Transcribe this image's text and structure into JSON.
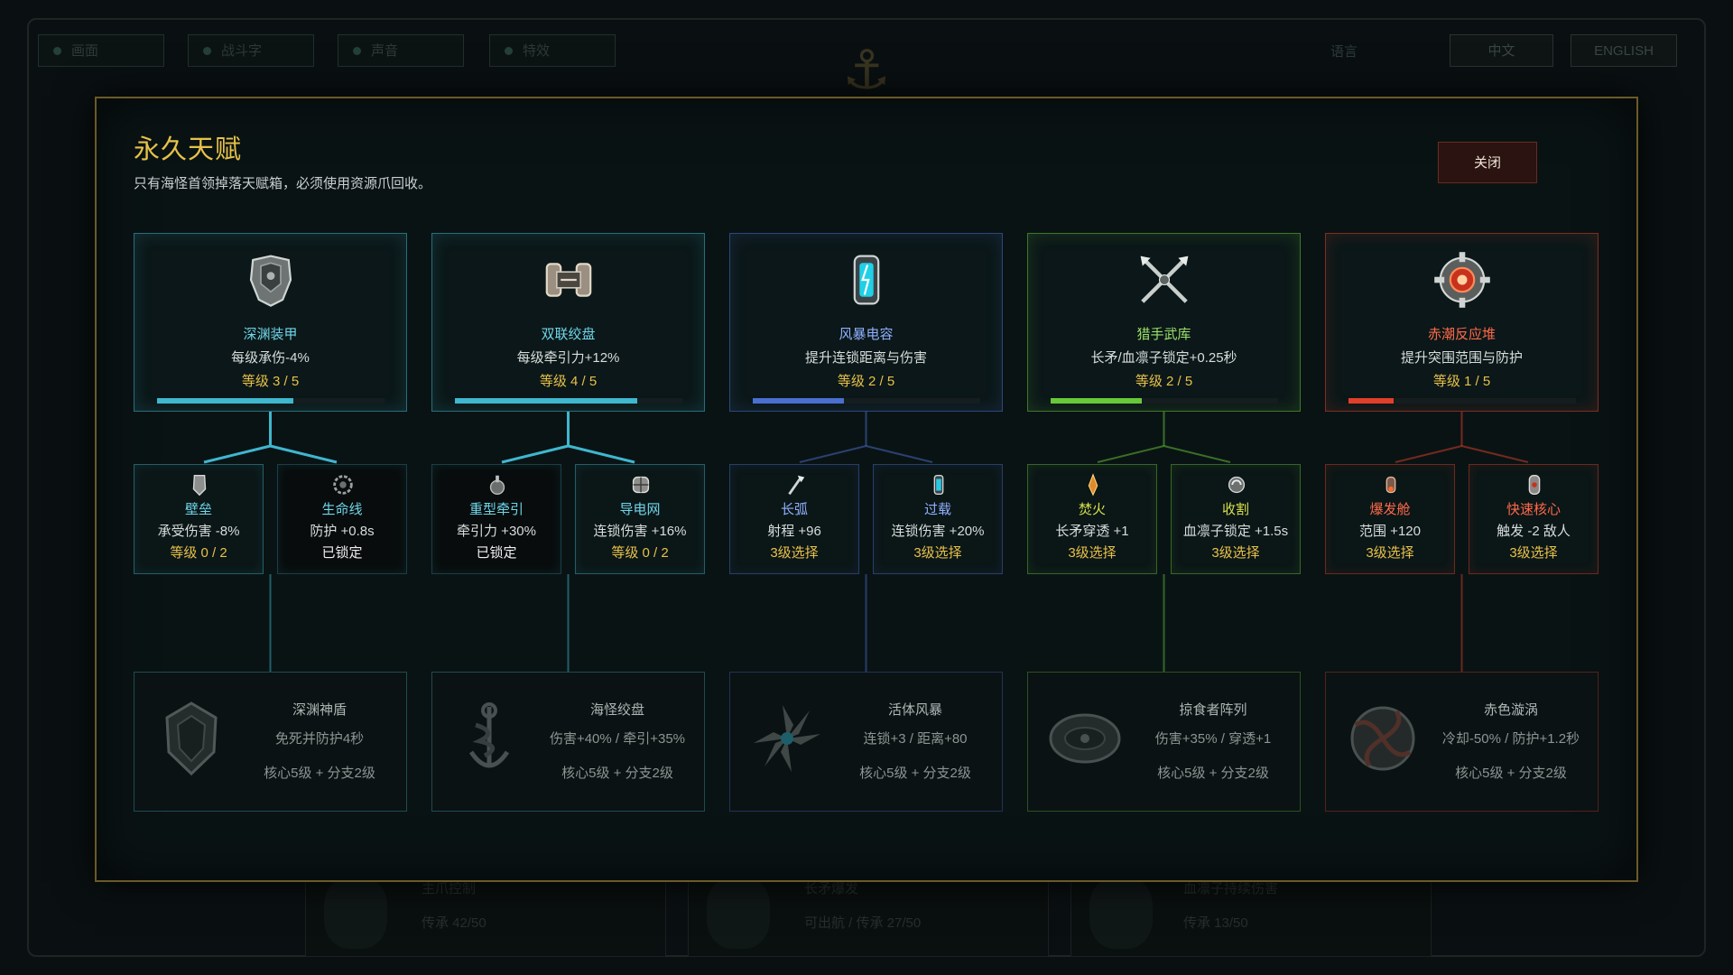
{
  "background": {
    "tabs": [
      "画面",
      "战斗字",
      "声音",
      "特效"
    ],
    "lang_label": "语言",
    "lang_options": [
      "中文",
      "ENGLISH"
    ],
    "cards": [
      {
        "title": "主爪控制",
        "sub": "传承 42/50"
      },
      {
        "title": "长矛爆发",
        "sub": "可出航 / 传承 27/50"
      },
      {
        "title": "血凛子持续伤害",
        "sub": "传承 13/50"
      }
    ]
  },
  "modal": {
    "title": "永久天赋",
    "subtitle": "只有海怪首领掉落天赋箱，必须使用资源爪回收。",
    "close_label": "关闭"
  },
  "colors": {
    "panel1": "#3fb7cf",
    "panel2": "#3fb7cf",
    "panel3": "#4a6fd0",
    "panel4": "#67c93a",
    "panel5": "#e0402a",
    "gold": "#e7c14a"
  },
  "panels": [
    {
      "theme": "#3fb7cf",
      "core": {
        "icon": "armor-icon",
        "name": "深渊装甲",
        "desc": "每级承伤-4%",
        "level": "等级 3 / 5",
        "progress": 0.6
      },
      "branches": [
        {
          "icon": "shield-wall-icon",
          "name": "壁垒",
          "desc": "承受伤害 -8%",
          "state": "等级 0 / 2",
          "locked": false
        },
        {
          "icon": "lifeline-icon",
          "name": "生命线",
          "desc": "防护 +0.8s",
          "state": "已锁定",
          "locked": true
        }
      ],
      "ultimate": {
        "icon": "abyss-shield-icon",
        "name": "深渊神盾",
        "desc": "免死并防护4秒",
        "req": "核心5级 + 分支2级"
      }
    },
    {
      "theme": "#3fb7cf",
      "core": {
        "icon": "winch-icon",
        "name": "双联绞盘",
        "desc": "每级牵引力+12%",
        "level": "等级 4 / 5",
        "progress": 0.8
      },
      "branches": [
        {
          "icon": "heavy-tow-icon",
          "name": "重型牵引",
          "desc": "牵引力 +30%",
          "state": "已锁定",
          "locked": true
        },
        {
          "icon": "conductive-net-icon",
          "name": "导电网",
          "desc": "连锁伤害 +16%",
          "state": "等级 0 / 2",
          "locked": false
        }
      ],
      "ultimate": {
        "icon": "sea-monster-winch-icon",
        "name": "海怪绞盘",
        "desc": "伤害+40% / 牵引+35%",
        "req": "核心5级 + 分支2级"
      }
    },
    {
      "theme": "#4a6fd0",
      "core": {
        "icon": "storm-capacitor-icon",
        "name": "风暴电容",
        "desc": "提升连锁距离与伤害",
        "level": "等级 2 / 5",
        "progress": 0.4
      },
      "branches": [
        {
          "icon": "long-arc-icon",
          "name": "长弧",
          "desc": "射程 +96",
          "state": "3级选择",
          "locked": false
        },
        {
          "icon": "overload-icon",
          "name": "过载",
          "desc": "连锁伤害 +20%",
          "state": "3级选择",
          "locked": false
        }
      ],
      "ultimate": {
        "icon": "living-storm-icon",
        "name": "活体风暴",
        "desc": "连锁+3 / 距离+80",
        "req": "核心5级 + 分支2级"
      }
    },
    {
      "theme": "#67c93a",
      "core": {
        "icon": "crossed-spears-icon",
        "name": "猎手武库",
        "desc": "长矛/血凛子锁定+0.25秒",
        "level": "等级 2 / 5",
        "progress": 0.4
      },
      "branches": [
        {
          "icon": "flame-icon",
          "name": "焚火",
          "desc": "长矛穿透 +1",
          "state": "3级选择",
          "locked": false
        },
        {
          "icon": "harvest-icon",
          "name": "收割",
          "desc": "血凛子锁定 +1.5s",
          "state": "3级选择",
          "locked": false
        }
      ],
      "ultimate": {
        "icon": "predator-array-icon",
        "name": "掠食者阵列",
        "desc": "伤害+35% / 穿透+1",
        "req": "核心5级 + 分支2级"
      }
    },
    {
      "theme": "#e0402a",
      "core": {
        "icon": "reactor-core-icon",
        "name": "赤潮反应堆",
        "desc": "提升突围范围与防护",
        "level": "等级 1 / 5",
        "progress": 0.2
      },
      "branches": [
        {
          "icon": "burst-chamber-icon",
          "name": "爆发舱",
          "desc": "范围 +120",
          "state": "3级选择",
          "locked": false
        },
        {
          "icon": "fast-core-icon",
          "name": "快速核心",
          "desc": "触发 -2 敌人",
          "state": "3级选择",
          "locked": false
        }
      ],
      "ultimate": {
        "icon": "crimson-vortex-icon",
        "name": "赤色漩涡",
        "desc": "冷却-50% / 防护+1.2秒",
        "req": "核心5级 + 分支2级"
      }
    }
  ]
}
